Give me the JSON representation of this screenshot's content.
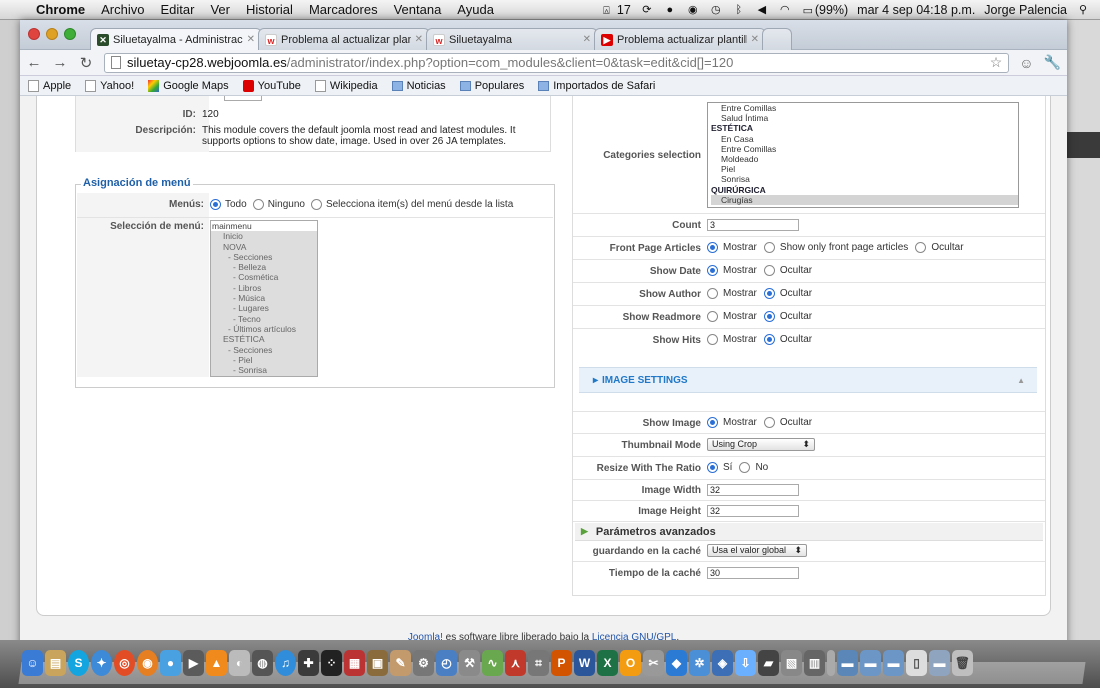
{
  "menubar": {
    "app": "Chrome",
    "items": [
      "Archivo",
      "Editar",
      "Ver",
      "Historial",
      "Marcadores",
      "Ventana",
      "Ayuda"
    ],
    "adobe_count": "17",
    "battery": "(99%)",
    "datetime": "mar 4 sep  04:18 p.m.",
    "user": "Jorge Palencia"
  },
  "browser": {
    "tabs": [
      {
        "title": "Siluetayalma - Administració",
        "active": true
      },
      {
        "title": "Problema al actualizar planti",
        "active": false
      },
      {
        "title": "Siluetayalma",
        "active": false
      },
      {
        "title": "Problema actualizar plantilla",
        "active": false
      }
    ],
    "url_host": "siluetay-cp28.webjoomla.es",
    "url_path": "/administrator/index.php?option=com_modules&client=0&task=edit&cid[]=120",
    "bookmarks": [
      "Apple",
      "Yahoo!",
      "Google Maps",
      "YouTube",
      "Wikipedia",
      "Noticias",
      "Populares",
      "Importados de Safari"
    ]
  },
  "details": {
    "id_label": "ID:",
    "id_value": "120",
    "desc_label": "Descripción:",
    "desc_value": "This module covers the default joomla most read and latest modules. It supports options to show date, image. Used in over 26 JA templates."
  },
  "menu_assignment": {
    "legend": "Asignación de menú",
    "menus_label": "Menús:",
    "options": [
      "Todo",
      "Ninguno",
      "Selecciona item(s) del menú desde la lista"
    ],
    "selection_label": "Selección de menú:",
    "menu_items": [
      "mainmenu",
      "Inicio",
      "NOVA",
      "- Secciones",
      "- Belleza",
      "- Cosmética",
      "- Libros",
      "- Música",
      "- Lugares",
      "- Tecno",
      "- Últimos artículos",
      "ESTÉTICA",
      "- Secciones",
      "- Piel",
      "- Sonrisa"
    ]
  },
  "params": {
    "categories_label": "Categories selection",
    "categories": [
      {
        "text": "Entre Comillas",
        "type": "c"
      },
      {
        "text": "Salud Íntima",
        "type": "c"
      },
      {
        "text": "ESTÉTICA",
        "type": "h"
      },
      {
        "text": "En Casa",
        "type": "c"
      },
      {
        "text": "Entre Comillas",
        "type": "c"
      },
      {
        "text": "Moldeado",
        "type": "c"
      },
      {
        "text": "Piel",
        "type": "c"
      },
      {
        "text": "Sonrisa",
        "type": "c"
      },
      {
        "text": "QUIRÚRGICA",
        "type": "h"
      },
      {
        "text": "Cirugías",
        "type": "c"
      }
    ],
    "count_label": "Count",
    "count_value": "3",
    "front_page_label": "Front Page Articles",
    "front_page_options": [
      "Mostrar",
      "Show only front page articles",
      "Ocultar"
    ],
    "show_date_label": "Show Date",
    "show_author_label": "Show Author",
    "show_readmore_label": "Show Readmore",
    "show_hits_label": "Show Hits",
    "opt_show": "Mostrar",
    "opt_hide": "Ocultar",
    "image_settings_title": "IMAGE SETTINGS",
    "show_image_label": "Show Image",
    "thumbnail_label": "Thumbnail Mode",
    "thumbnail_value": "Using Crop",
    "resize_label": "Resize With The Ratio",
    "opt_yes": "Sí",
    "opt_no": "No",
    "width_label": "Image Width",
    "width_value": "32",
    "height_label": "Image Height",
    "height_value": "32",
    "advanced_title": "Parámetros avanzados",
    "cache_label": "guardando en la caché",
    "cache_value": "Usa el valor global",
    "cache_time_label": "Tiempo de la caché",
    "cache_time_value": "30"
  },
  "footer": {
    "joomla": "Joomla!",
    "text": " es software libre liberado bajo la ",
    "license": "Licencia GNU/GPL",
    "end": "."
  }
}
